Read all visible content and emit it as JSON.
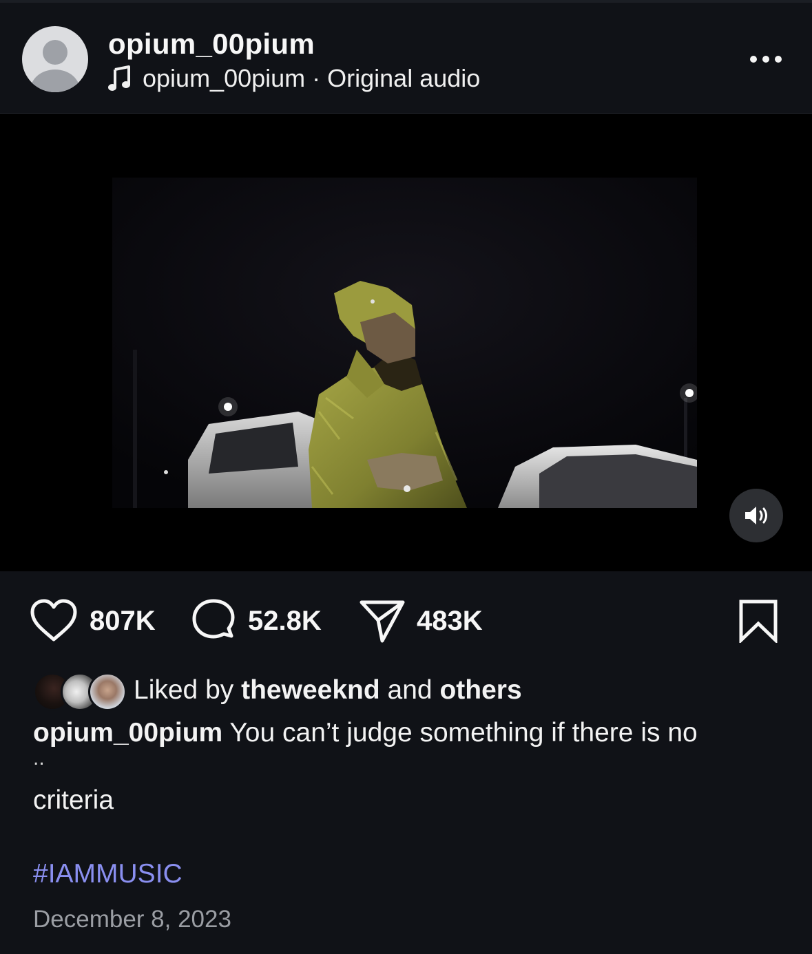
{
  "header": {
    "username": "opium_00pium",
    "audio_owner": "opium_00pium",
    "audio_separator": "·",
    "audio_label": "Original audio",
    "more_icon": "more-horizontal-icon"
  },
  "media": {
    "sound_icon": "speaker-on-icon"
  },
  "actions": {
    "likes": "807K",
    "comments": "52.8K",
    "shares": "483K"
  },
  "liked_by": {
    "prefix": "Liked by",
    "user": "theweeknd",
    "connector": "and",
    "others": "others"
  },
  "caption": {
    "username": "opium_00pium",
    "text": "You can’t judge something if there is no",
    "ellipsis": "..",
    "continued": "criteria"
  },
  "hashtag": "#IAMMUSIC",
  "date": "December 8, 2023",
  "colors": {
    "background": "#101217",
    "hashtag": "#8a8ff0",
    "date": "#9b9ea4"
  }
}
